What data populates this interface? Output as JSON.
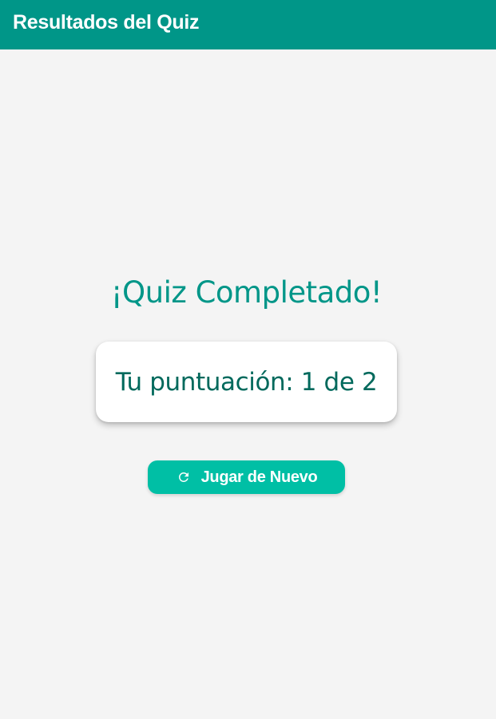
{
  "app_bar": {
    "title": "Resultados del Quiz",
    "color": "#009688"
  },
  "main": {
    "heading": "¡Quiz Completado!",
    "score_text": "Tu puntuación: 1 de 2",
    "replay_button": {
      "label": "Jugar de Nuevo",
      "icon": "refresh-icon",
      "color": "#00bfa5"
    }
  }
}
